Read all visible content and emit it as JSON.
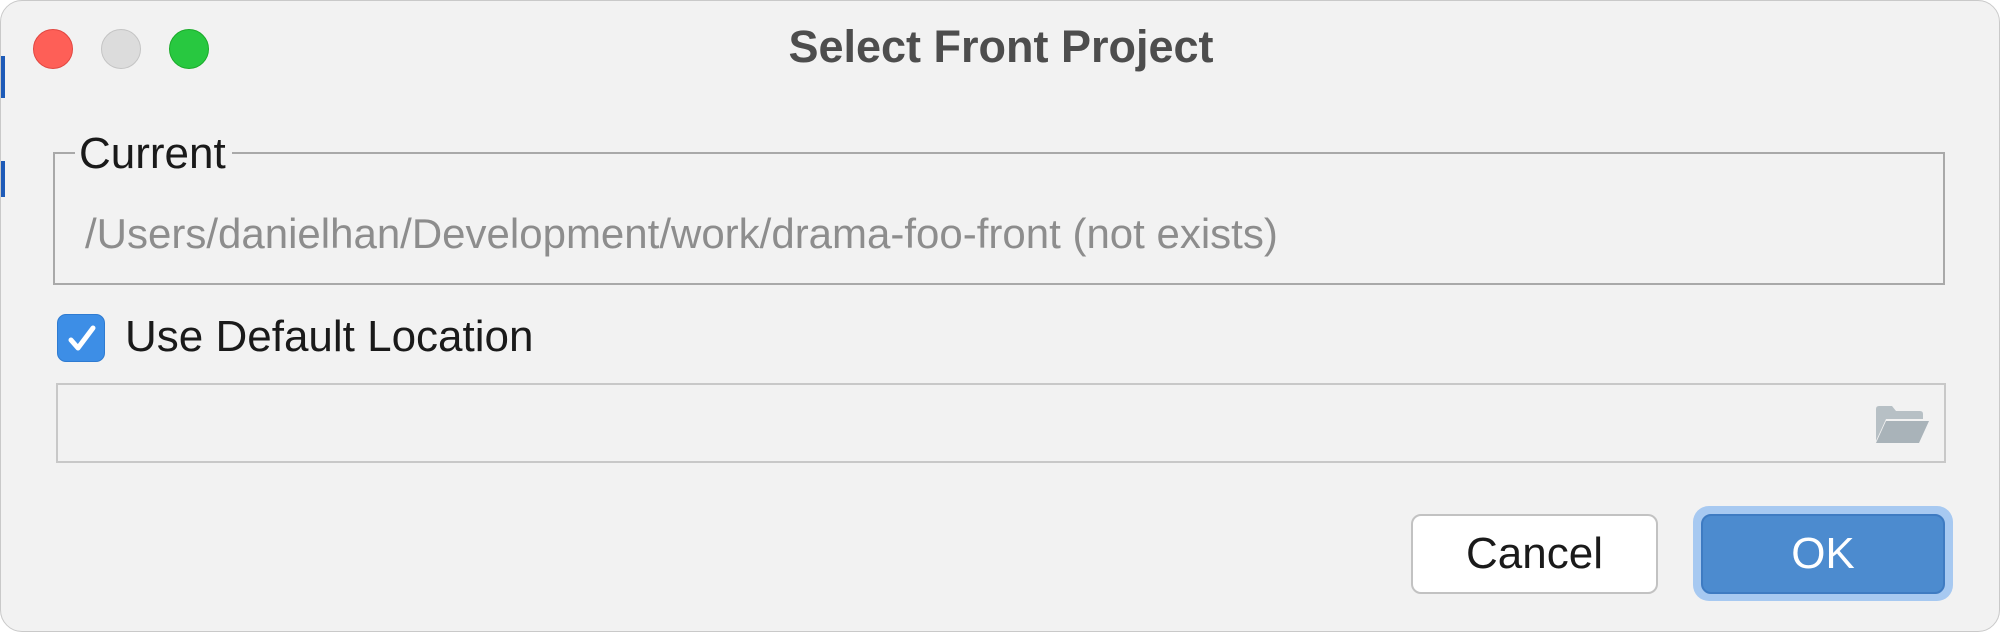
{
  "window": {
    "title": "Select Front Project",
    "controls": [
      "close",
      "minimize",
      "zoom"
    ]
  },
  "current_group": {
    "legend": "Current",
    "path": "/Users/danielhan/Development/work/drama-foo-front (not exists)"
  },
  "use_default": {
    "label": "Use Default Location",
    "checked": true
  },
  "location_field": {
    "value": "",
    "browse_icon": "folder-icon"
  },
  "buttons": {
    "cancel_label": "Cancel",
    "ok_label": "OK"
  },
  "colors": {
    "accent": "#4c8bcf",
    "checkbox": "#3d8ee6",
    "close": "#fe5f57",
    "zoom": "#28c840"
  }
}
